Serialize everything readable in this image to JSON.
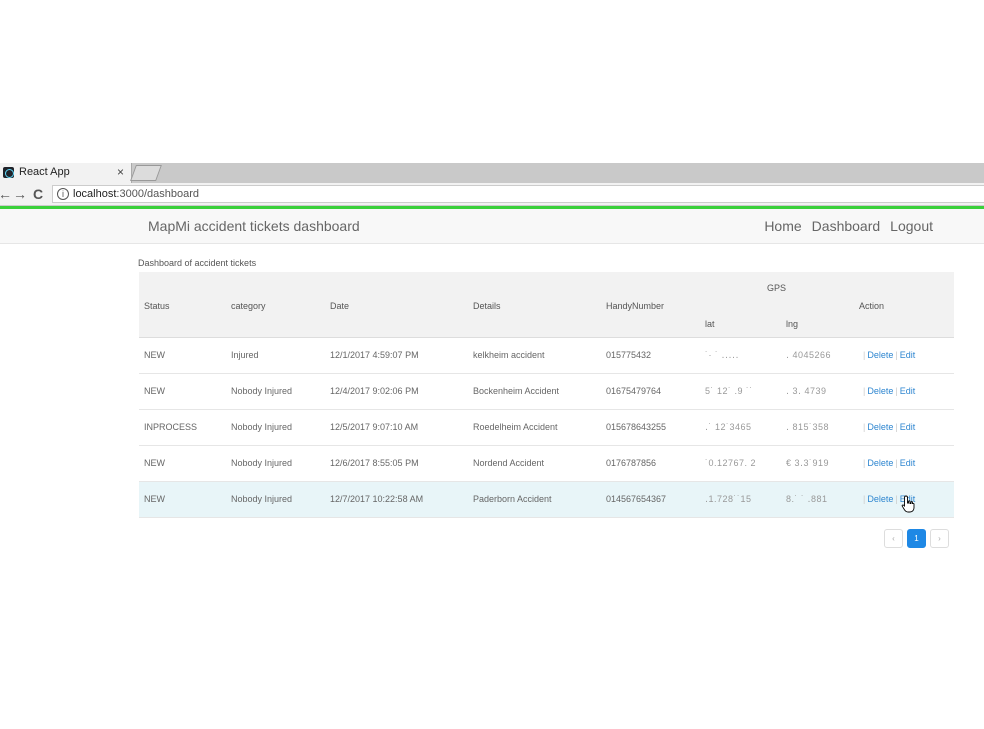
{
  "browser": {
    "tab_title": "React App",
    "tab_close": "×",
    "back": "←",
    "forward": "→",
    "reload": "C",
    "url_host": "localhost",
    "url_rest": ":3000/dashboard"
  },
  "app": {
    "brand": "MapMi accident tickets dashboard",
    "nav": [
      "Home",
      "Dashboard",
      "Logout"
    ]
  },
  "table": {
    "caption": "Dashboard of accident tickets",
    "headers": {
      "status": "Status",
      "category": "category",
      "date": "Date",
      "details": "Details",
      "handy": "HandyNumber",
      "gps": "GPS",
      "lat": "lat",
      "lng": "lng",
      "action": "Action"
    },
    "rows": [
      {
        "status": "NEW",
        "category": "Injured",
        "date": "12/1/2017 4:59:07 PM",
        "details": "kelkheim accident",
        "handy": "015775432",
        "lat": "˙· ˙ ․․․․․",
        "lng": "․ 4045266"
      },
      {
        "status": "NEW",
        "category": "Nobody Injured",
        "date": "12/4/2017 9:02:06 PM",
        "details": "Bockenheim Accident",
        "handy": "01675479764",
        "lat": "5˙ 12˙ .9 ˙˙",
        "lng": "․ 3․ 4739"
      },
      {
        "status": "INPROCESS",
        "category": "Nobody Injured",
        "date": "12/5/2017 9:07:10 AM",
        "details": "Roedelheim Accident",
        "handy": "015678643255",
        "lat": "․˙ 12˙3465",
        "lng": "․ 815˙358"
      },
      {
        "status": "NEW",
        "category": "Nobody Injured",
        "date": "12/6/2017 8:55:05 PM",
        "details": "Nordend Accident",
        "handy": "0176787856",
        "lat": "˙0.12767. 2",
        "lng": "€ 3․3˙919"
      },
      {
        "status": "NEW",
        "category": "Nobody Injured",
        "date": "12/7/2017 10:22:58 AM",
        "details": "Paderborn Accident",
        "handy": "014567654367",
        "lat": "․1.728˙˙15",
        "lng": "8.˙ ˙ ․881"
      }
    ],
    "delete_label": "Delete",
    "edit_label": "Edit",
    "separator": "|"
  },
  "pagination": {
    "prev": "‹",
    "current": "1",
    "next": "›"
  }
}
